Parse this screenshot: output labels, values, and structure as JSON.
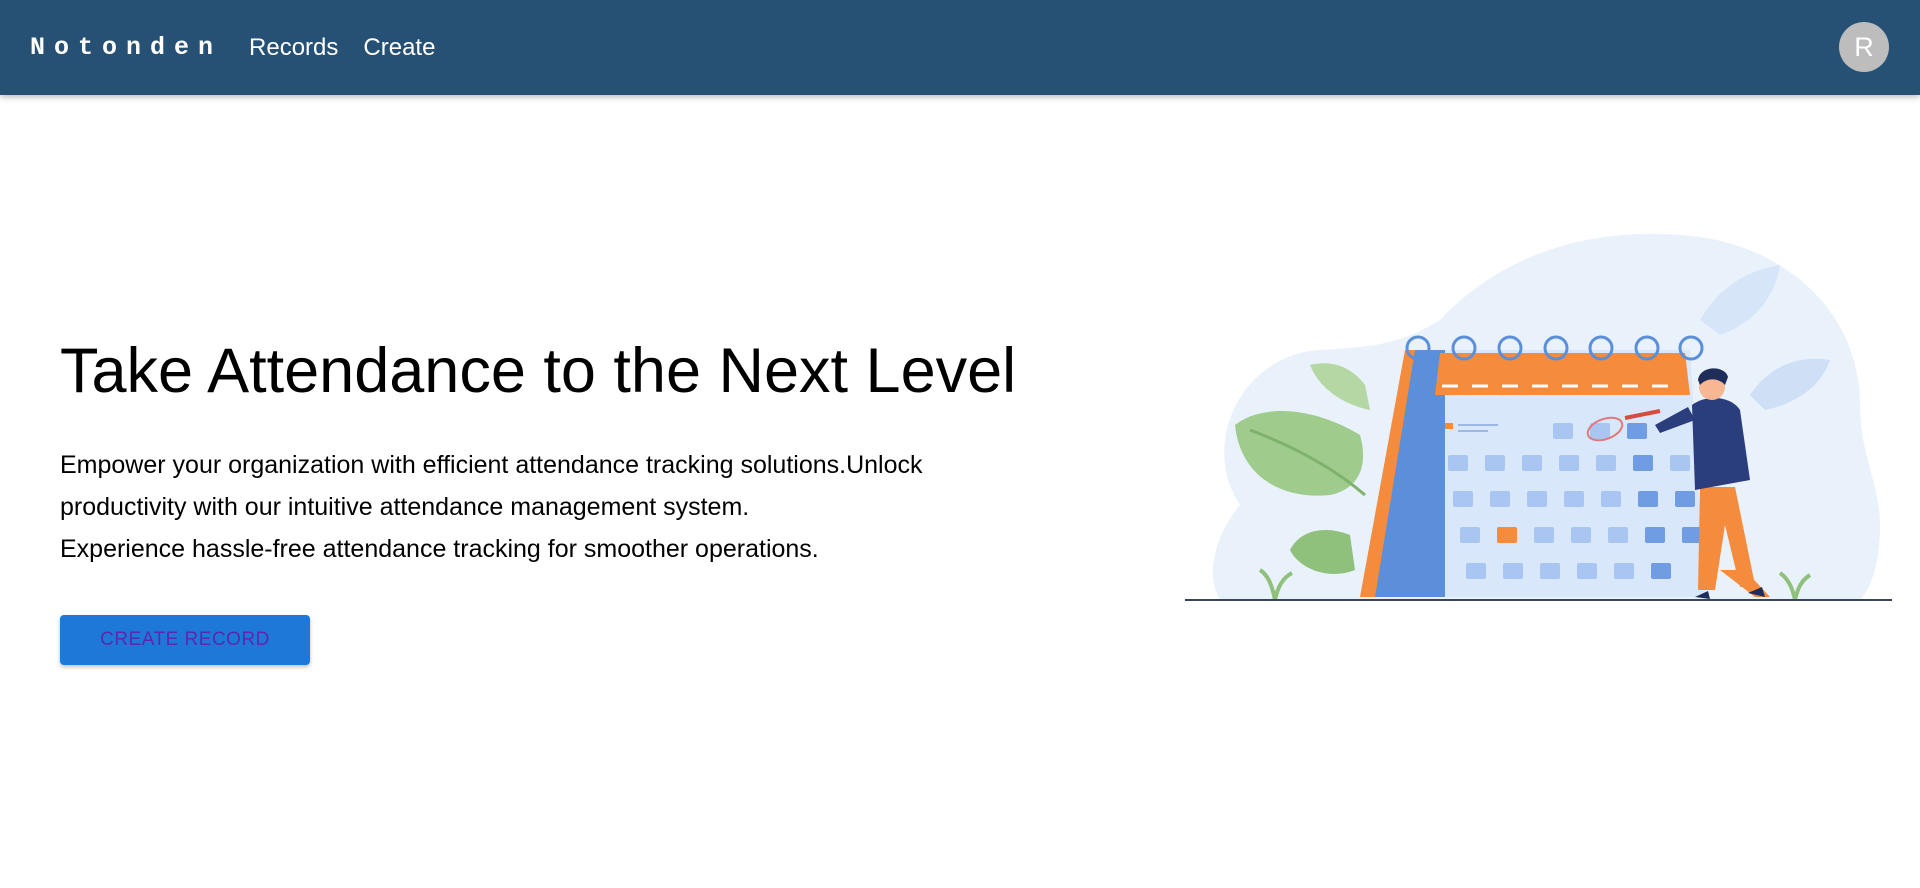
{
  "header": {
    "brand": "Notonden",
    "nav": [
      {
        "label": "Records"
      },
      {
        "label": "Create"
      }
    ],
    "avatar_initial": "R",
    "bg_color": "#265175"
  },
  "hero": {
    "title": "Take Attendance to the Next Level",
    "lines": [
      "Empower your organization with efficient attendance tracking solutions.Unlock productivity with our intuitive attendance management system.",
      "Experience hassle-free attendance tracking for smoother operations."
    ],
    "cta_label": "CREATE RECORD",
    "cta_color": "#1e78d8"
  },
  "illustration": {
    "icon": "calendar-person-illustration",
    "accent": "#f58b3c"
  }
}
